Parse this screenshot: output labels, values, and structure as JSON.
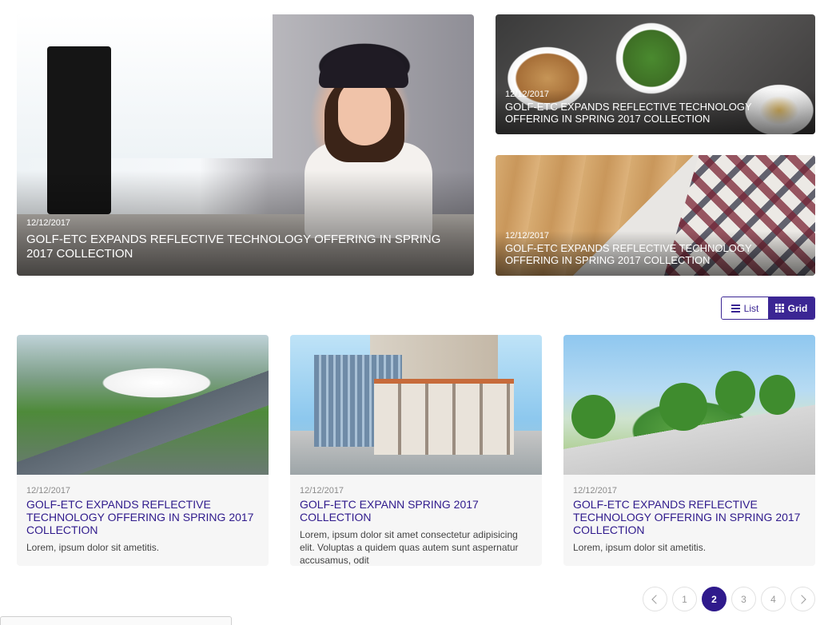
{
  "featured": {
    "main": {
      "date": "12/12/2017",
      "title": "golf-etc EXPANDS REFLECTIVE TECHNOLOGY OFFERING IN SPRING 2017 COLLECTION"
    },
    "side_top": {
      "date": "12/12/2017",
      "title": "golf-etc EXPANDS REFLECTIVE TECHNOLOGY OFFERING IN SPRING 2017 COLLECTION"
    },
    "side_bottom": {
      "date": "12/12/2017",
      "title": "golf-etc EXPANDS REFLECTIVE TECHNOLOGY OFFERING IN SPRING 2017 COLLECTION"
    }
  },
  "view_toggle": {
    "list_label": "List",
    "grid_label": "Grid",
    "selected": "Grid"
  },
  "cards": [
    {
      "date": "12/12/2017",
      "title": "golf-etc EXPANDS REFLECTIVE TECHNOLOGY OFFERING IN SPRING 2017 COLLECTION",
      "excerpt": "Lorem, ipsum dolor sit ametitis."
    },
    {
      "date": "12/12/2017",
      "title": "golf-etc EXPANN SPRING 2017 COLLECTION",
      "excerpt": "Lorem, ipsum dolor sit amet consectetur adipisicing elit. Voluptas a quidem quas autem sunt aspernatur accusamus, odit"
    },
    {
      "date": "12/12/2017",
      "title": "golf-etc EXPANDS REFLECTIVE TECHNOLOGY OFFERING IN SPRING 2017 COLLECTION",
      "excerpt": "Lorem, ipsum dolor sit ametitis."
    }
  ],
  "pagination": {
    "pages": [
      "1",
      "2",
      "3",
      "4"
    ],
    "current": "2",
    "prev_icon": "chevron-left-icon",
    "next_icon": "chevron-right-icon"
  },
  "colors": {
    "accent": "#2f1a8c",
    "card_bg": "#f6f6f6"
  }
}
